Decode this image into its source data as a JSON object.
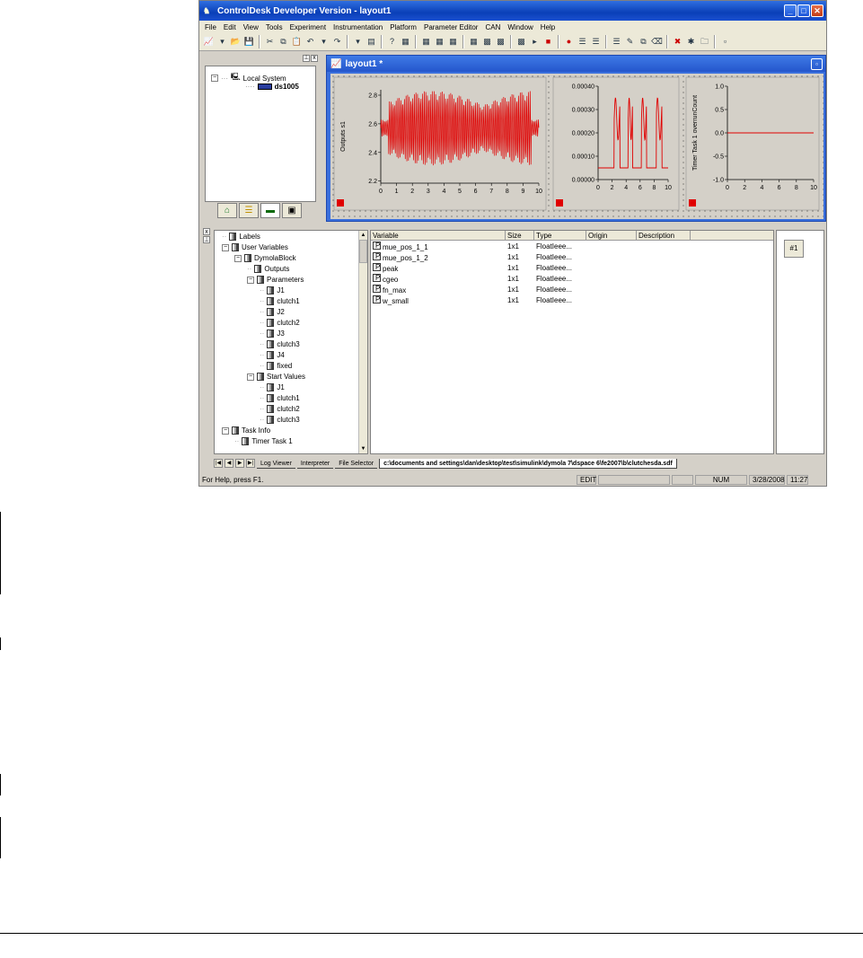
{
  "window": {
    "title": "ControlDesk Developer Version - layout1",
    "buttons": {
      "minimize": "_",
      "maximize": "□",
      "close": "✕"
    }
  },
  "menu": [
    "File",
    "Edit",
    "View",
    "Tools",
    "Experiment",
    "Instrumentation",
    "Platform",
    "Parameter Editor",
    "CAN",
    "Window",
    "Help"
  ],
  "toolbar_icons": [
    "chart-icon",
    "down-arrow-icon",
    "open-folder-icon",
    "save-icon",
    "cut-icon",
    "copy-icon",
    "paste-icon",
    "undo-icon",
    "down-arrow-icon",
    "redo-icon",
    "down-arrow-icon",
    "properties-icon",
    "help-pointer-icon",
    "layout-icon",
    "layout-icon",
    "layout-icon",
    "layout-icon",
    "layout-icon",
    "instrument-icon",
    "instrument-icon",
    "instrument-icon",
    "play-icon",
    "stop-icon",
    "record-icon",
    "list-icon",
    "list-icon",
    "list-icon",
    "edit-icon",
    "copy-icon",
    "eraser-icon",
    "delete-icon",
    "settings-icon",
    "folder-icon",
    "disabled-icon"
  ],
  "navigator": {
    "tree": [
      {
        "label": "Local System",
        "level": 0
      },
      {
        "label": "ds1005",
        "level": 1,
        "bold": true
      }
    ]
  },
  "layout_window": {
    "title": "layout1 *"
  },
  "plots": [
    {
      "ylabel": "Outputs s1",
      "yticks": [
        "2.8",
        "2.6",
        "2.4",
        "2.2"
      ],
      "xticks": [
        "0",
        "1",
        "2",
        "3",
        "4",
        "5",
        "6",
        "7",
        "8",
        "9",
        "10"
      ]
    },
    {
      "ylabel": "",
      "yticks": [
        "0.00040",
        "0.00030",
        "0.00020",
        "0.00010",
        "0.00000"
      ],
      "xticks": [
        "0",
        "2",
        "4",
        "6",
        "8",
        "10"
      ]
    },
    {
      "ylabel": "Timer Task 1 overrunCount",
      "yticks": [
        "1.0",
        "0.5",
        "0.0",
        "-0.5",
        "-1.0"
      ],
      "xticks": [
        "0",
        "2",
        "4",
        "6",
        "8",
        "10"
      ]
    }
  ],
  "chart_data": [
    {
      "type": "line",
      "ylabel": "Outputs s1",
      "ylim": [
        2.2,
        2.9
      ],
      "xlim": [
        0,
        10
      ],
      "series": [
        {
          "values_description_free": true,
          "x": [
            0,
            10
          ],
          "y": [
            2.57,
            2.57
          ]
        }
      ]
    },
    {
      "type": "line",
      "ylabel": "",
      "ylim": [
        0,
        0.0004
      ],
      "xlim": [
        0,
        10
      ],
      "series": [
        {
          "x": [
            0,
            10
          ],
          "y": [
            5e-05,
            5e-05
          ]
        }
      ]
    },
    {
      "type": "line",
      "ylabel": "Timer Task 1 overrunCount",
      "ylim": [
        -1,
        1
      ],
      "xlim": [
        0,
        10
      ],
      "series": [
        {
          "x": [
            0,
            10
          ],
          "y": [
            0,
            0
          ]
        }
      ]
    }
  ],
  "variable_tree": [
    {
      "label": "Labels",
      "level": 0
    },
    {
      "label": "User Variables",
      "level": 0
    },
    {
      "label": "DymolaBlock",
      "level": 1
    },
    {
      "label": "Outputs",
      "level": 2
    },
    {
      "label": "Parameters",
      "level": 2
    },
    {
      "label": "J1",
      "level": 3
    },
    {
      "label": "clutch1",
      "level": 3
    },
    {
      "label": "J2",
      "level": 3
    },
    {
      "label": "clutch2",
      "level": 3
    },
    {
      "label": "J3",
      "level": 3
    },
    {
      "label": "clutch3",
      "level": 3
    },
    {
      "label": "J4",
      "level": 3
    },
    {
      "label": "fixed",
      "level": 3
    },
    {
      "label": "Start Values",
      "level": 2
    },
    {
      "label": "J1",
      "level": 3
    },
    {
      "label": "clutch1",
      "level": 3
    },
    {
      "label": "clutch2",
      "level": 3
    },
    {
      "label": "clutch3",
      "level": 3
    },
    {
      "label": "Task Info",
      "level": 0
    },
    {
      "label": "Timer Task 1",
      "level": 1
    }
  ],
  "variable_table": {
    "columns": [
      "Variable",
      "Size",
      "Type",
      "Origin",
      "Description"
    ],
    "rows": [
      {
        "variable": "mue_pos_1_1",
        "size": "1x1",
        "type": "FloatIeee..."
      },
      {
        "variable": "mue_pos_1_2",
        "size": "1x1",
        "type": "FloatIeee..."
      },
      {
        "variable": "peak",
        "size": "1x1",
        "type": "FloatIeee..."
      },
      {
        "variable": "cgeo",
        "size": "1x1",
        "type": "FloatIeee..."
      },
      {
        "variable": "fn_max",
        "size": "1x1",
        "type": "FloatIeee..."
      },
      {
        "variable": "w_small",
        "size": "1x1",
        "type": "FloatIeee..."
      }
    ]
  },
  "right_panel": {
    "button": "#1"
  },
  "bottom_tabs": [
    "Log Viewer",
    "Interpreter",
    "File Selector",
    "c:\\documents and settings\\dan\\desktop\\test\\simulink\\dymola 7\\dspace 6\\fe2007\\b\\clutchesda.sdf"
  ],
  "status": {
    "help": "For Help, press F1.",
    "mode": "EDIT",
    "num": "NUM",
    "date": "3/28/2008",
    "time": "11:27"
  }
}
